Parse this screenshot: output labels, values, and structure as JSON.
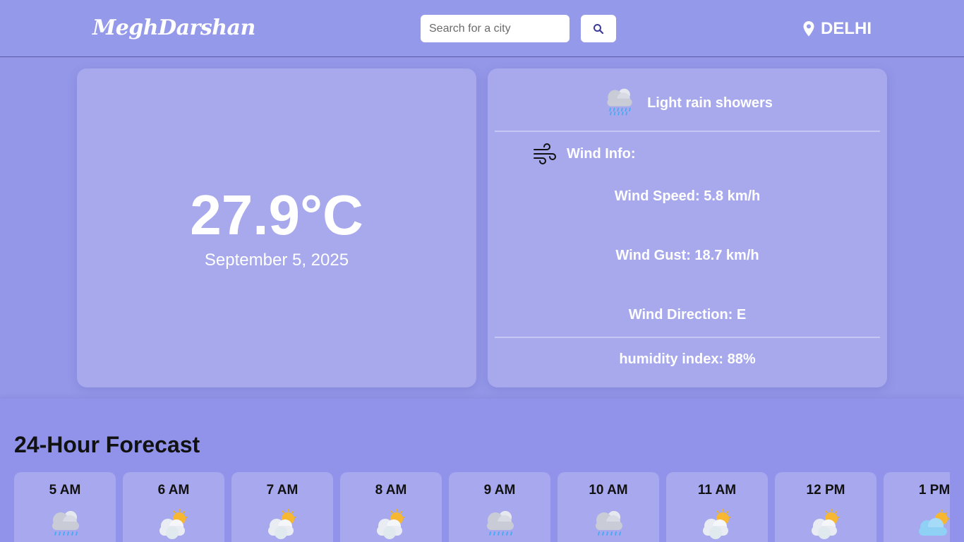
{
  "header": {
    "logo": "MeghDarshan",
    "search_placeholder": "Search for a city",
    "location": "DELHI"
  },
  "current": {
    "temperature": "27.9°C",
    "date": "September 5, 2025"
  },
  "details": {
    "condition": "Light rain showers",
    "condition_icon": "rain-cloud-icon",
    "wind_title": "Wind Info:",
    "wind_speed": "Wind Speed: 5.8 km/h",
    "wind_gust": "Wind Gust: 18.7 km/h",
    "wind_direction": "Wind Direction: E",
    "humidity": "humidity index: 88%"
  },
  "forecast": {
    "title": "24-Hour Forecast",
    "hours": [
      {
        "time": "5 AM",
        "icon": "rain-cloud-icon"
      },
      {
        "time": "6 AM",
        "icon": "partly-sunny-icon"
      },
      {
        "time": "7 AM",
        "icon": "partly-sunny-icon"
      },
      {
        "time": "8 AM",
        "icon": "partly-sunny-icon"
      },
      {
        "time": "9 AM",
        "icon": "rain-cloud-icon"
      },
      {
        "time": "10 AM",
        "icon": "rain-cloud-icon"
      },
      {
        "time": "11 AM",
        "icon": "partly-sunny-icon"
      },
      {
        "time": "12 PM",
        "icon": "partly-sunny-icon"
      },
      {
        "time": "1 PM",
        "icon": "sun-behind-cloud-icon"
      }
    ]
  },
  "colors": {
    "background": "#9497e8",
    "card": "rgba(255,255,255,0.18)",
    "text_light": "#ffffff",
    "text_dark": "#111111"
  }
}
